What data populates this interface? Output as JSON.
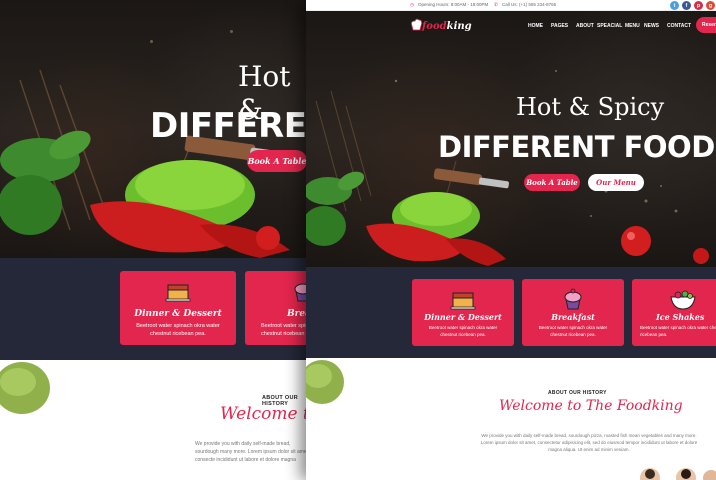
{
  "colors": {
    "accent": "#e3264d",
    "band": "#242838",
    "hero_dark": "#1b1714"
  },
  "topbar": {
    "hours": "Opening Hours: 8:00AM - 18:00PM",
    "phone": "Call Us: (+1) 555 234-8765",
    "social": [
      "twitter-icon",
      "facebook-icon",
      "pinterest-icon",
      "google-plus-icon"
    ]
  },
  "logo": {
    "main": "food",
    "suffix": "king"
  },
  "nav": {
    "items": [
      "HOME",
      "PAGES",
      "ABOUT",
      "SPEACIAL",
      "MENU",
      "NEWS",
      "CONTACT"
    ],
    "reserve": "Reserva"
  },
  "hero": {
    "script": "Hot & Spicy",
    "headline": "DIFFERENT FOOD|",
    "back_script": "Hot &",
    "back_headline": "DIFFEREN",
    "book_button": "Book A Table",
    "menu_button": "Our Menu"
  },
  "cards": [
    {
      "title": "Dinner & Dessert",
      "text": "Beetroot water spinach okra water chestnut ricebean pea.",
      "icon": "cake-icon"
    },
    {
      "title": "Breakfast",
      "text": "Beetroot water spinach okra water chestnut ricebean pea.",
      "icon": "cupcake-icon"
    },
    {
      "title": "Ice Shakes",
      "text": "Beetroot water spinach okra water chestnut ricebean pea.",
      "icon": "salad-icon"
    }
  ],
  "back_cards": [
    {
      "title": "Dinner & Dessert",
      "text": "Beetroot water spinach okra water chestnut ricebean pea."
    },
    {
      "title": "Breakf",
      "text": "Beetroot water spinach okra water chestnut ricebean pea."
    }
  ],
  "about": {
    "label": "ABOUT OUR HISTORY",
    "title": "Welcome to The Foodking",
    "back_title": "Welcome to T",
    "text": "We provide you with daily self-made bread, sourdough pizza, roasted fish mean vegetables and many more. Lorem ipsum dolor sit amet, consectetur adipisicing elit, sed do eiusmod tempor incididunt ut labore et dolore magna aliqua. Ut enim ad minim veniam.",
    "back_text": "We provide you with daily self-made bread, sourdough many more. Lorem ipsum dolor sit amet, consecte incididunt ut labore et dolore magna"
  }
}
